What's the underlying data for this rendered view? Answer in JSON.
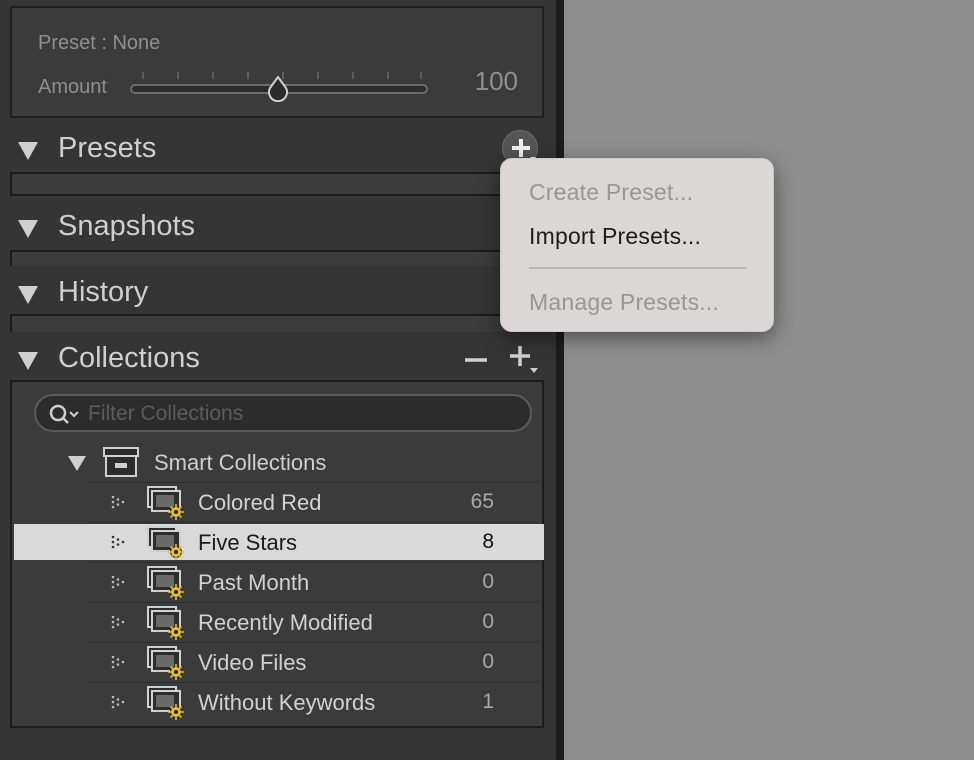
{
  "develop_panel": {
    "preset_line": "Preset : None",
    "amount_label": "Amount",
    "amount_value": "100",
    "amount_level": 0.5
  },
  "sections": {
    "presets": "Presets",
    "snapshots": "Snapshots",
    "history": "History",
    "collections": "Collections"
  },
  "collections": {
    "filter_placeholder": "Filter Collections",
    "group_label": "Smart Collections",
    "items": [
      {
        "label": "Colored Red",
        "count": "65",
        "selected": false
      },
      {
        "label": "Five Stars",
        "count": "8",
        "selected": true
      },
      {
        "label": "Past Month",
        "count": "0",
        "selected": false
      },
      {
        "label": "Recently Modified",
        "count": "0",
        "selected": false
      },
      {
        "label": "Video Files",
        "count": "0",
        "selected": false
      },
      {
        "label": "Without Keywords",
        "count": "1",
        "selected": false
      }
    ]
  },
  "preset_menu": {
    "create": "Create Preset...",
    "import": "Import Presets...",
    "manage": "Manage Presets..."
  },
  "colors": {
    "panel_bg": "#353535",
    "canvas_bg": "#8e8e8e",
    "selection_bg": "#d9d9d9",
    "menu_bg": "#dcd7d7",
    "smart_badge": "#e3b93a"
  },
  "icons": {
    "section_toggle": "disclosure-triangle-icon",
    "add": "plus-icon",
    "remove": "minus-icon",
    "search": "search-icon",
    "group": "collection-set-box-icon",
    "smart_collection": "smart-collection-icon"
  }
}
